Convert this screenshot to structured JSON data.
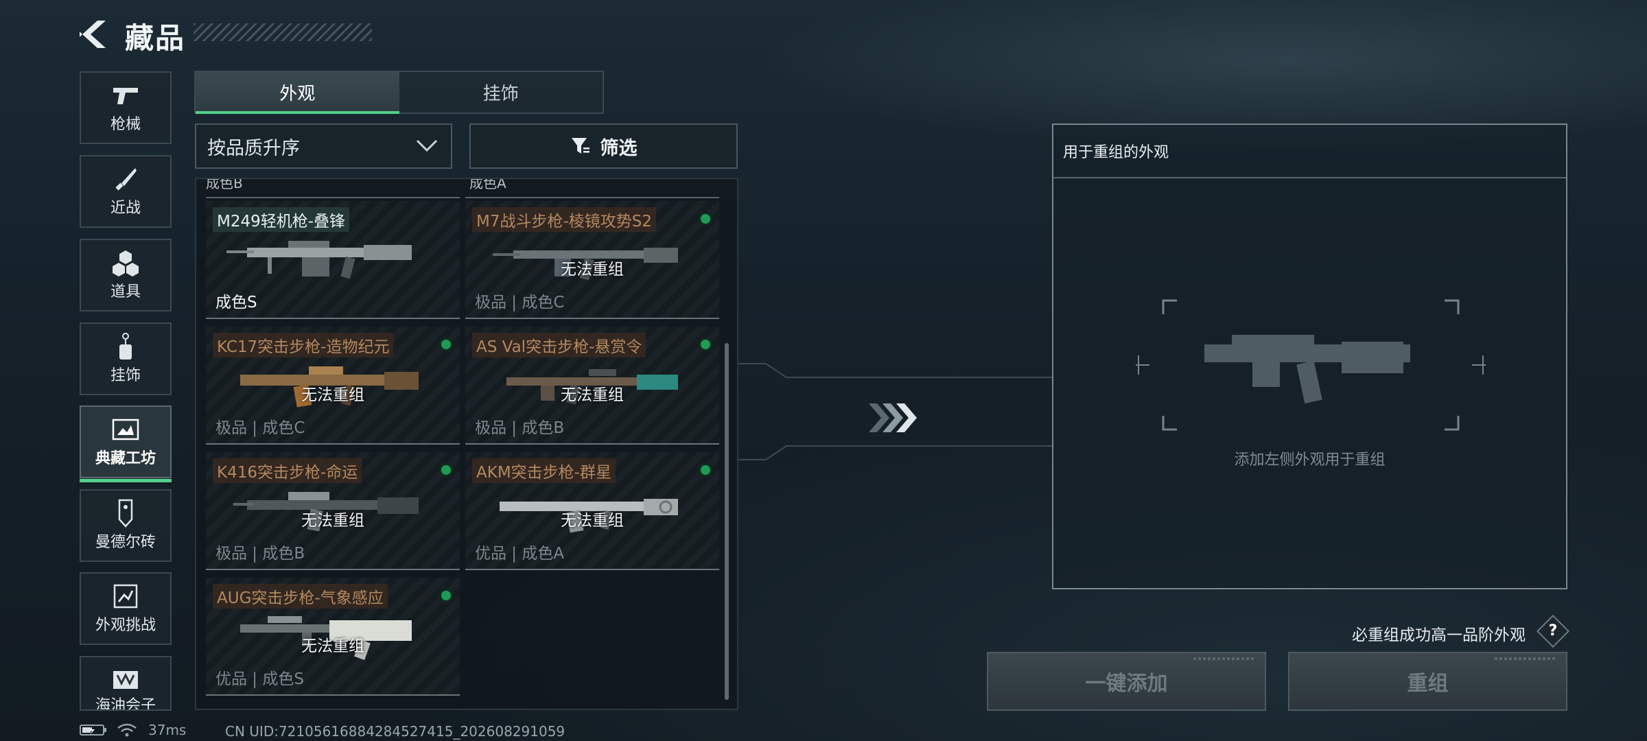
{
  "header": {
    "title": "藏品"
  },
  "side_nav": [
    {
      "label": "枪械",
      "icon": "pistol-icon"
    },
    {
      "label": "近战",
      "icon": "knife-icon"
    },
    {
      "label": "道具",
      "icon": "cubes-icon"
    },
    {
      "label": "挂饰",
      "icon": "charm-icon"
    },
    {
      "label": "典藏工坊",
      "icon": "workshop-icon",
      "active": true
    },
    {
      "label": "曼德尔砖",
      "icon": "brick-icon"
    },
    {
      "label": "外观挑战",
      "icon": "challenge-icon"
    },
    {
      "label": "海油会子",
      "icon": "chest-icon"
    }
  ],
  "tabs": [
    {
      "label": "外观",
      "active": true
    },
    {
      "label": "挂饰"
    }
  ],
  "sort": {
    "label": "按品质升序"
  },
  "filter": {
    "label": "筛选"
  },
  "grid": {
    "top_stubs": [
      "成色B",
      "成色A"
    ],
    "items": [
      {
        "name": "M249轻机枪-叠锋",
        "quality": "成色S",
        "selected": true,
        "owned": false,
        "status": ""
      },
      {
        "name": "M7战斗步枪-棱镜攻势S2",
        "quality": "极品 | 成色C",
        "owned": true,
        "status": "无法重组"
      },
      {
        "name": "KC17突击步枪-造物纪元",
        "quality": "极品 | 成色C",
        "owned": true,
        "status": "无法重组"
      },
      {
        "name": "AS Val突击步枪-悬赏令",
        "quality": "极品 | 成色B",
        "owned": true,
        "status": "无法重组"
      },
      {
        "name": "K416突击步枪-命运",
        "quality": "极品 | 成色B",
        "owned": true,
        "status": "无法重组"
      },
      {
        "name": "AKM突击步枪-群星",
        "quality": "优品 | 成色A",
        "owned": true,
        "status": "无法重组"
      },
      {
        "name": "AUG突击步枪-气象感应",
        "quality": "优品 | 成色S",
        "owned": true,
        "status": "无法重组"
      }
    ]
  },
  "recombine_panel": {
    "title": "用于重组的外观",
    "hint": "添加左侧外观用于重组"
  },
  "guarantee": {
    "text": "必重组成功高一品阶外观",
    "help": "?"
  },
  "buttons": {
    "add_all": "一键添加",
    "recombine": "重组"
  },
  "status_bar": {
    "ping": "37ms",
    "uid": "CN UID:7210561688428452741​5_202608291059"
  },
  "colors": {
    "accent": "#52d08c",
    "owned_dot": "#1f9a55"
  }
}
